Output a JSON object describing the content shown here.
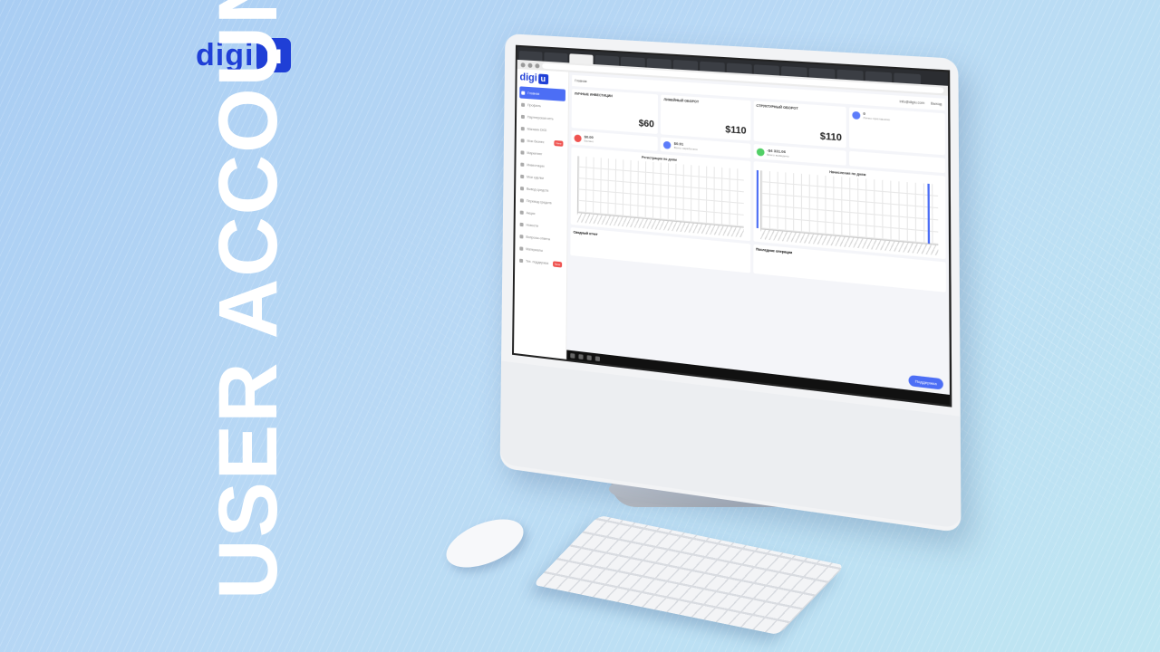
{
  "brand": {
    "logo_text": "digi",
    "logo_box": "u"
  },
  "headline": "USER ACCOUNT",
  "monitor_ui": {
    "sidebar": {
      "items": [
        {
          "label": "Главная",
          "active": true
        },
        {
          "label": "Профиль"
        },
        {
          "label": "Партнерская сеть"
        },
        {
          "label": "Магазин DIGI"
        },
        {
          "label": "Мои бизнес",
          "badge": "New"
        },
        {
          "label": "Маркетинг"
        },
        {
          "label": "Инвестиции"
        },
        {
          "label": "Мои сделки"
        },
        {
          "label": "Вывод средств"
        },
        {
          "label": "Перевод средств"
        },
        {
          "label": "Акции"
        },
        {
          "label": "Новости"
        },
        {
          "label": "Вопросы-ответы"
        },
        {
          "label": "Материалы"
        },
        {
          "label": "Тех. поддержка",
          "badge": "New"
        }
      ]
    },
    "topbar": {
      "title": "Главная",
      "email": "info@digiu.com",
      "exit": "Выход"
    },
    "cards": {
      "personal_invest": {
        "title": "Личные инвестиции",
        "amount": "$60"
      },
      "linear_turnover": {
        "title": "Линейный оборот",
        "amount": "$110"
      },
      "structural_turnover": {
        "title": "Структурный оборот",
        "amount": "$110"
      },
      "stat1": {
        "value": "$0.00",
        "label": "Баланс"
      },
      "stat2": {
        "value": "$0.91",
        "label": "Всего заработано"
      },
      "stat3": {
        "value": "-$4 331.06",
        "label": "Всего выведено"
      },
      "stat4": {
        "value": "0",
        "label": "Лично приглашено"
      }
    },
    "charts": {
      "registrations": "Регистрации по дням",
      "accruals": "Начисления по дням",
      "summary": "Сводный отчет",
      "last_ops": "Последние операции"
    },
    "support_button": "Поддержка"
  },
  "chart_data": [
    {
      "type": "bar",
      "title": "Регистрации по дням",
      "values_note": "",
      "categories": [],
      "values": [
        0,
        0,
        0,
        0,
        0,
        0,
        0,
        0,
        0,
        0,
        0,
        0,
        0,
        0,
        0,
        0,
        0,
        0,
        0,
        0,
        0,
        0,
        0,
        0,
        0,
        0,
        0,
        0,
        0,
        0,
        0,
        0,
        0,
        0,
        0,
        0,
        0,
        0,
        0,
        1
      ],
      "ylim": [
        0,
        1
      ]
    },
    {
      "type": "bar",
      "title": "Начисления по дням",
      "categories": [],
      "values": [
        0,
        0,
        0,
        0,
        0,
        0,
        0,
        0,
        0,
        0,
        0,
        0,
        0,
        0,
        0,
        0,
        0,
        0,
        0,
        0,
        0,
        0,
        0,
        0,
        0,
        0,
        0,
        0,
        0,
        0,
        0,
        0,
        0,
        0,
        1,
        0,
        0,
        0,
        0,
        0
      ],
      "ylim": [
        0,
        1
      ]
    }
  ]
}
